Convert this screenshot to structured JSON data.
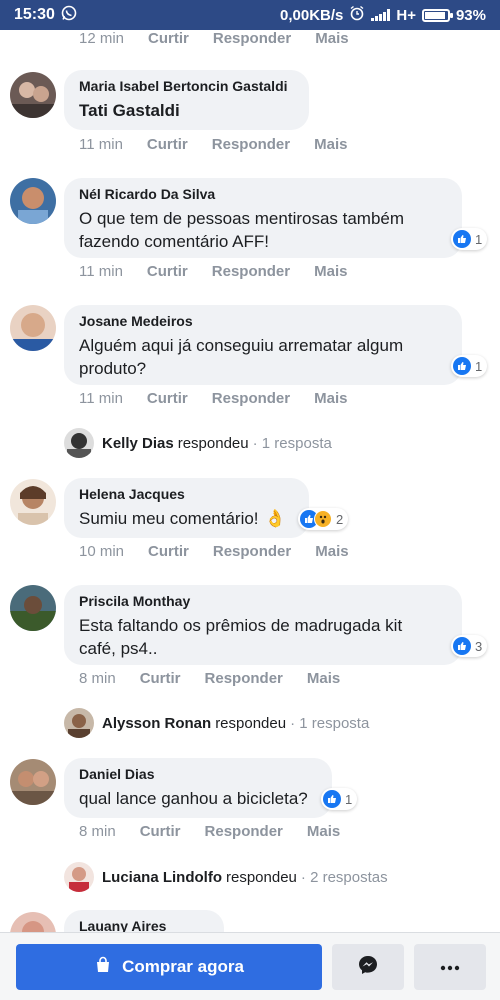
{
  "status_bar": {
    "time": "15:30",
    "network_speed": "0,00KB/s",
    "network_type": "H+",
    "battery_percent": "93%",
    "battery_level": 0.93,
    "icons": [
      "whatsapp-icon",
      "alarm-icon",
      "signal-icon",
      "battery-icon"
    ]
  },
  "actions": {
    "like": "Curtir",
    "reply": "Responder",
    "more": "Mais"
  },
  "top_meta": {
    "time": "12 min"
  },
  "comments": [
    {
      "author": "Maria Isabel Bertoncin Gastaldi",
      "text": "Tati Gastaldi",
      "time": "11 min"
    },
    {
      "author": "Nél Ricardo Da Silva",
      "text_lines": [
        "O que tem de pessoas mentirosas também",
        "fazendo comentário AFF!"
      ],
      "time": "11 min",
      "reactions": "1"
    },
    {
      "author": "Josane Medeiros",
      "text_lines": [
        "Alguém aqui já conseguiu arrematar algum",
        "produto?"
      ],
      "time": "11 min",
      "reactions": "1",
      "reply": {
        "name": "Kelly Dias",
        "verb": "respondeu",
        "count": "· 1 resposta"
      }
    },
    {
      "author": "Helena Jacques",
      "text": "Sumiu meu comentário!",
      "emoji": "👌",
      "time": "10 min",
      "reactions": "2"
    },
    {
      "author": "Priscila Monthay",
      "text_lines": [
        "Esta faltando os prêmios de madrugada kit",
        "café, ps4.."
      ],
      "time": "8 min",
      "reactions": "3",
      "reply": {
        "name": "Alysson Ronan",
        "verb": "respondeu",
        "count": "· 1 resposta"
      }
    },
    {
      "author": "Daniel Dias",
      "text": "qual lance ganhou a bicicleta?",
      "time": "8 min",
      "reactions": "1",
      "reply": {
        "name": "Luciana Lindolfo",
        "verb": "respondeu",
        "count": "· 2 respostas"
      }
    },
    {
      "author": "Lauany Aires"
    }
  ],
  "bottom_bar": {
    "buy_label": "Comprar agora",
    "colors": {
      "accent": "#2f6de1",
      "status_bar": "#2d4a86"
    }
  }
}
